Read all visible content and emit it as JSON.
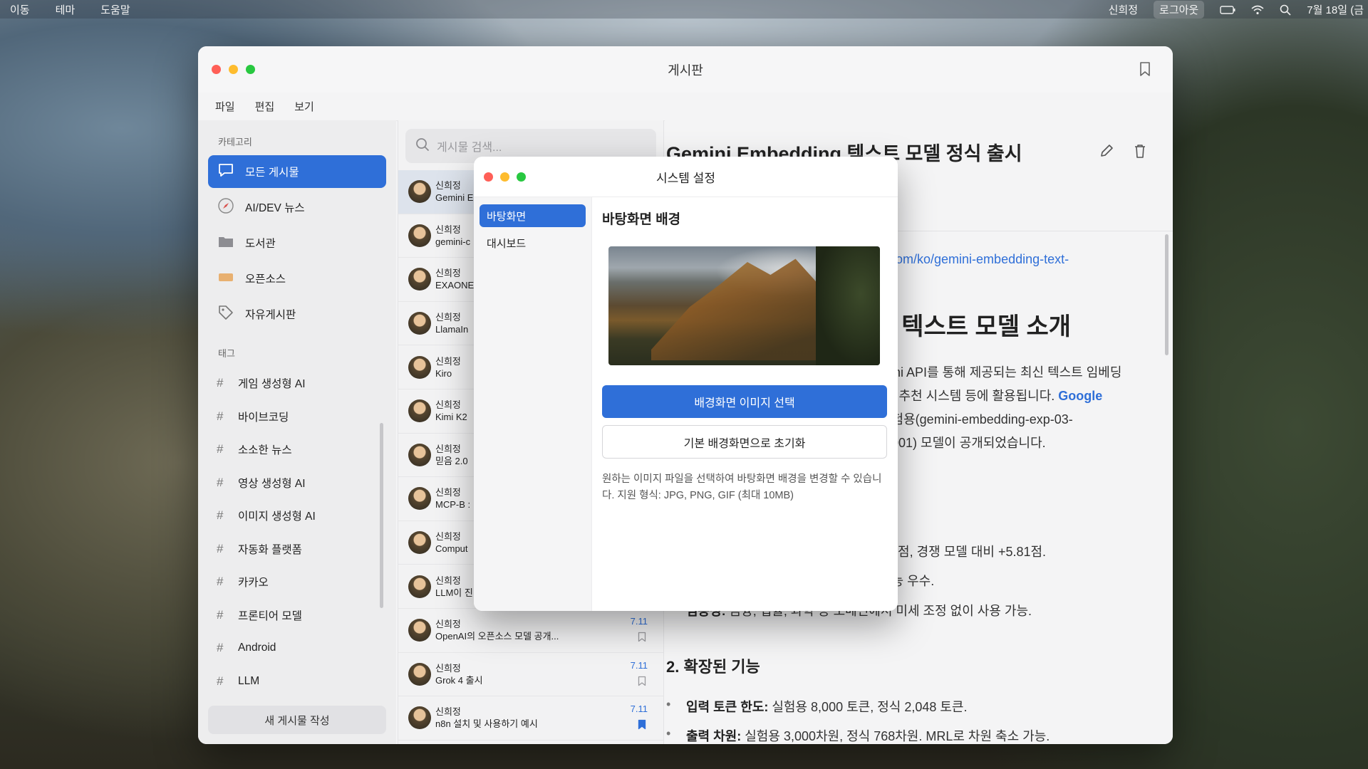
{
  "menubar": {
    "left": [
      "이동",
      "테마",
      "도움말"
    ],
    "user": "신희정",
    "logout": "로그아웃",
    "date": "7월 18일 (금"
  },
  "window": {
    "title": "게시판",
    "menu": [
      "파일",
      "편집",
      "보기"
    ]
  },
  "sidebar": {
    "category_header": "카테고리",
    "categories": [
      {
        "label": "모든 게시물",
        "icon": "chat-bubble-icon"
      },
      {
        "label": "AI/DEV 뉴스",
        "icon": "compass-icon"
      },
      {
        "label": "도서관",
        "icon": "folder-icon"
      },
      {
        "label": "오픈소스",
        "icon": "tag-orange-icon"
      },
      {
        "label": "자유게시판",
        "icon": "tag-outline-icon"
      }
    ],
    "tag_header": "태그",
    "tags": [
      "게임 생성형 AI",
      "바이브코딩",
      "소소한 뉴스",
      "영상 생성형 AI",
      "이미지 생성형 AI",
      "자동화 플랫폼",
      "카카오",
      "프론티어 모델",
      "Android",
      "LLM"
    ],
    "new_post": "새 게시물 작성"
  },
  "postlist": {
    "search_placeholder": "게시물 검색...",
    "posts": [
      {
        "author": "신희정",
        "title": "Gemini E",
        "date": "",
        "bookmarked": false
      },
      {
        "author": "신희정",
        "title": "gemini-c",
        "date": "",
        "bookmarked": false
      },
      {
        "author": "신희정",
        "title": "EXAONE",
        "date": "",
        "bookmarked": false
      },
      {
        "author": "신희정",
        "title": "LlamaIn",
        "date": "",
        "bookmarked": false
      },
      {
        "author": "신희정",
        "title": "Kiro",
        "date": "",
        "bookmarked": false
      },
      {
        "author": "신희정",
        "title": "Kimi K2",
        "date": "",
        "bookmarked": false
      },
      {
        "author": "신희정",
        "title": "믿음 2.0",
        "date": "",
        "bookmarked": false
      },
      {
        "author": "신희정",
        "title": "MCP-B :",
        "date": "",
        "bookmarked": false
      },
      {
        "author": "신희정",
        "title": "Comput",
        "date": "",
        "bookmarked": false
      },
      {
        "author": "신희정",
        "title": "LLM이 진",
        "date": "",
        "bookmarked": false
      },
      {
        "author": "신희정",
        "title": "OpenAI의 오픈소스 모델 공개...",
        "date": "7.11",
        "bookmarked": false
      },
      {
        "author": "신희정",
        "title": "Grok 4 출시",
        "date": "7.11",
        "bookmarked": false
      },
      {
        "author": "신희정",
        "title": "n8n 설치 및 사용하기 예시",
        "date": "7.11",
        "bookmarked": true
      }
    ]
  },
  "detail": {
    "title": "Gemini Embedding 텍스트 모델 정식 출시",
    "link": "g.com/ko/gemini-embedding-text-",
    "heading": "g 텍스트 모델 소개",
    "para1": "mini API를 통해 제공되는 최신 텍스트 임베딩",
    "para2a": "류, 추천 시스템 등에 활용됩니다. ",
    "para2b": "Google",
    "para3": "실험용(gemini-embedding-exp-03-",
    "para4": "g-001) 모델이 공개되었습니다.",
    "bullet1": ".32점, 경쟁 모델 대비 +5.81점.",
    "bullet2": "성능 우수.",
    "bullet3_label": "범용성:",
    "bullet3": " 금융, 법률, 과학 등 도메인에서 미세 조정 없이 사용 가능.",
    "h2": "2. 확장된 기능",
    "bullet4_label": "입력 토큰 한도:",
    "bullet4": " 실험용 8,000 토큰, 정식 2,048 토큰.",
    "bullet5_label": "출력 차원:",
    "bullet5": " 실험용 3,000차원, 정식 768차원. MRL로 차원 축소 가능."
  },
  "modal": {
    "title": "시스템 설정",
    "side": [
      "바탕화면",
      "대시보드"
    ],
    "heading": "바탕화면 배경",
    "btn_select": "배경화면 이미지 선택",
    "btn_reset": "기본 배경화면으로 초기화",
    "note": "원하는 이미지 파일을 선택하여 바탕화면 배경을 변경할 수 있습니다. 지원 형식: JPG, PNG, GIF (최대 10MB)"
  },
  "colors": {
    "accent": "#2f6fd8",
    "close": "#ff5f57",
    "minimize": "#febc2e",
    "zoom": "#28c840"
  }
}
